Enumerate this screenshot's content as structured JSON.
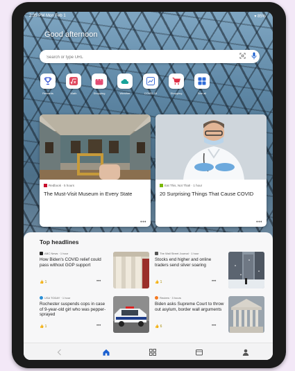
{
  "status_bar": {
    "time": "2:35 PM  Mon Feb 1",
    "right": "▾ 85%"
  },
  "greeting": "Good afternoon",
  "search": {
    "placeholder": "Search or type URL"
  },
  "quick_links": [
    {
      "label": "Rewards",
      "icon": "trophy-icon",
      "color": "#3d5ad6"
    },
    {
      "label": "Math",
      "icon": "math-icon",
      "color": "#e0485e"
    },
    {
      "label": "Shopping",
      "icon": "shopping-bag-icon",
      "color": "#e34c73"
    },
    {
      "label": "Weather",
      "icon": "weather-cloud-icon",
      "color": "#18a39a"
    },
    {
      "label": "COVID-19",
      "icon": "covid-chart-icon",
      "color": "#3f6ed8"
    },
    {
      "label": "Shopping",
      "icon": "cart-icon",
      "color": "#e02f45"
    },
    {
      "label": "See all",
      "icon": "grid-icon",
      "color": "#2d6bd8"
    }
  ],
  "featured": [
    {
      "source": "Redbook · 5 hours",
      "title": "The Must-Visit Museum in Every State",
      "image": "museum-photo",
      "logo_color": "#c8102e"
    },
    {
      "source": "Eat This, Not That! · 1 hour",
      "title": "20 Surprising Things That Cause COVID",
      "image": "doctor-photo",
      "logo_color": "#7ab800"
    }
  ],
  "headlines": {
    "title": "Top headlines",
    "items": [
      {
        "source": "ABC News · 1 hour",
        "text": "How Biden's COVID relief could pass without GOP support",
        "likes": "👍 1",
        "image": "white-house-photo",
        "logo_color": "#222222"
      },
      {
        "source": "The Wall Street Journal · 1 hour",
        "text": "Stocks end higher and online traders send silver soaring",
        "likes": "👍 1",
        "image": "wall-street-snow-photo",
        "logo_color": "#555555"
      },
      {
        "source": "USA TODAY · 1 hour",
        "text": "Rochester suspends cops in case of 9-year-old girl who was pepper-sprayed",
        "likes": "👍 1",
        "image": "police-car-photo",
        "logo_color": "#2a8fd6"
      },
      {
        "source": "Reuters · 3 hours",
        "text": "Biden asks Supreme Court to throw out asylum, border wall arguments",
        "likes": "👍 6",
        "image": "supreme-court-photo",
        "logo_color": "#f47920"
      }
    ]
  },
  "nav": [
    {
      "name": "back",
      "icon": "back-arrow-icon"
    },
    {
      "name": "home",
      "icon": "home-icon"
    },
    {
      "name": "apps",
      "icon": "apps-grid-icon"
    },
    {
      "name": "tabs",
      "icon": "tabs-icon"
    },
    {
      "name": "profile",
      "icon": "profile-icon"
    }
  ],
  "colors": {
    "accent": "#1a5fd0",
    "card_bg": "#ffffff",
    "panel_bg": "#f7f7f8"
  }
}
